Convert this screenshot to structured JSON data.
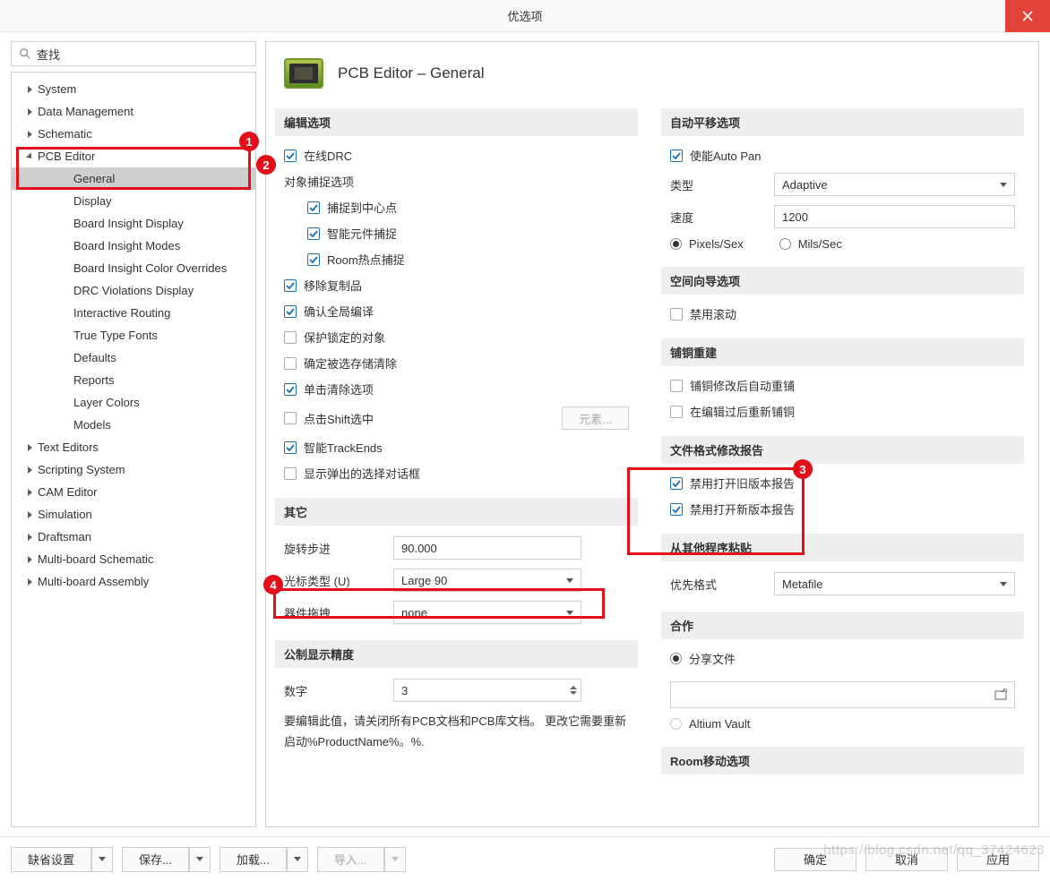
{
  "title": "优选项",
  "search_placeholder": "查找",
  "page_heading": "PCB Editor – General",
  "tree": {
    "items": [
      {
        "label": "System",
        "level": 1,
        "expanded": false
      },
      {
        "label": "Data Management",
        "level": 1,
        "expanded": false
      },
      {
        "label": "Schematic",
        "level": 1,
        "expanded": false
      },
      {
        "label": "PCB Editor",
        "level": 1,
        "expanded": true
      },
      {
        "label": "General",
        "level": 2,
        "selected": true
      },
      {
        "label": "Display",
        "level": 2
      },
      {
        "label": "Board Insight Display",
        "level": 2
      },
      {
        "label": "Board Insight Modes",
        "level": 2
      },
      {
        "label": "Board Insight Color Overrides",
        "level": 2
      },
      {
        "label": "DRC Violations Display",
        "level": 2
      },
      {
        "label": "Interactive Routing",
        "level": 2
      },
      {
        "label": "True Type Fonts",
        "level": 2
      },
      {
        "label": "Defaults",
        "level": 2
      },
      {
        "label": "Reports",
        "level": 2
      },
      {
        "label": "Layer Colors",
        "level": 2
      },
      {
        "label": "Models",
        "level": 2
      },
      {
        "label": "Text Editors",
        "level": 1,
        "expanded": false
      },
      {
        "label": "Scripting System",
        "level": 1,
        "expanded": false
      },
      {
        "label": "CAM Editor",
        "level": 1,
        "expanded": false
      },
      {
        "label": "Simulation",
        "level": 1,
        "expanded": false
      },
      {
        "label": "Draftsman",
        "level": 1,
        "expanded": false
      },
      {
        "label": "Multi-board Schematic",
        "level": 1,
        "expanded": false
      },
      {
        "label": "Multi-board Assembly",
        "level": 1,
        "expanded": false
      }
    ]
  },
  "left_col": {
    "edit_options_h": "编辑选项",
    "online_drc": "在线DRC",
    "obj_snap_h": "对象捕捉选项",
    "snap_center": "捕捉到中心点",
    "smart_component": "智能元件捕捉",
    "room_hotspot": "Room热点捕捉",
    "remove_dup": "移除复制品",
    "confirm_global": "确认全局编译",
    "protect_locked": "保护锁定的对象",
    "confirm_store_clear": "确定被选存储清除",
    "click_clear_sel": "单击清除选项",
    "shift_select": "点击Shift选中",
    "elements_btn": "元素...",
    "smart_trackends": "智能TrackEnds",
    "show_popup_dlg": "显示弹出的选择对话框",
    "other_h": "其它",
    "rotate_step_lbl": "旋转步进",
    "rotate_step_val": "90.000",
    "cursor_type_lbl": "光标类型 (U)",
    "cursor_type_val": "Large 90",
    "comp_drag_lbl": "器件拖拽",
    "comp_drag_val": "none",
    "metric_precision_h": "公制显示精度",
    "digits_lbl": "数字",
    "digits_val": "3",
    "note": "要编辑此值，请关闭所有PCB文档和PCB库文档。 更改它需要重新启动%ProductName%。%."
  },
  "right_col": {
    "autopan_h": "自动平移选项",
    "enable_autopan": "使能Auto Pan",
    "type_lbl": "类型",
    "type_val": "Adaptive",
    "speed_lbl": "速度",
    "speed_val": "1200",
    "unit_pixels": "Pixels/Sex",
    "unit_mils": "Mils/Sec",
    "space_nav_h": "空间向导选项",
    "disable_roll": "禁用滚动",
    "copper_h": "铺铜重建",
    "copper_auto": "铺铜修改后自动重铺",
    "copper_after_edit": "在编辑过后重新铺铜",
    "file_report_h": "文件格式修改报告",
    "old_ver": "禁用打开旧版本报告",
    "new_ver": "禁用打开新版本报告",
    "paste_h": "从其他程序粘贴",
    "pref_format_lbl": "优先格式",
    "pref_format_val": "Metafile",
    "collab_h": "合作",
    "share_file": "分享文件",
    "altium_vault": "Altium Vault",
    "room_move_h": "Room移动选项"
  },
  "footer": {
    "defaults": "缺省设置",
    "save": "保存... ",
    "load": "加载... ",
    "import": "导入...",
    "ok": "确定",
    "cancel": "取消",
    "apply": "应用"
  },
  "callouts": {
    "c1": "1",
    "c2": "2",
    "c3": "3",
    "c4": "4"
  },
  "watermark": "https://blog.csdn.net/qq_37424623"
}
